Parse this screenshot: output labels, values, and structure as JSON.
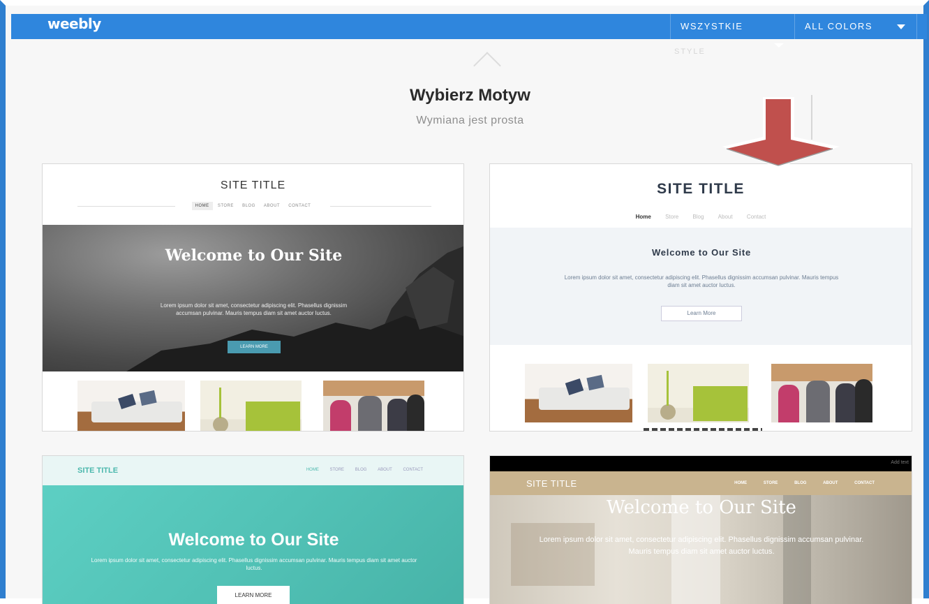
{
  "topbar": {
    "logo": "weebly",
    "style_filter": "WSZYSTKIE",
    "style_filter_wrap": "STYLE",
    "color_filter": "ALL COLORS"
  },
  "header": {
    "title": "Wybierz Motyw",
    "subtitle": "Wymiana jest prosta"
  },
  "colors": {
    "topbar": "#2f86dd",
    "annotation_arrow": "#c0504d"
  },
  "themes": [
    {
      "site_title": "SITE TITLE",
      "nav": [
        "HOME",
        "STORE",
        "BLOG",
        "ABOUT",
        "CONTACT"
      ],
      "active_nav": "HOME",
      "headline": "Welcome to Our Site",
      "body": "Lorem ipsum dolor sit amet, consectetur adipiscing elit. Phasellus dignissim accumsan pulvinar. Mauris tempus diam sit amet auctor luctus.",
      "button": "LEARN MORE"
    },
    {
      "site_title": "SITE TITLE",
      "nav": [
        "Home",
        "Store",
        "Blog",
        "About",
        "Contact"
      ],
      "active_nav": "Home",
      "headline": "Welcome to Our Site",
      "body": "Lorem ipsum dolor sit amet, consectetur adipiscing elit. Phasellus dignissim accumsan pulvinar. Mauris tempus diam sit amet auctor luctus.",
      "button": "Learn More"
    },
    {
      "site_title": "SITE TITLE",
      "nav": [
        "HOME",
        "STORE",
        "BLOG",
        "ABOUT",
        "CONTACT"
      ],
      "active_nav": "HOME",
      "headline": "Welcome to Our Site",
      "body": "Lorem ipsum dolor sit amet, consectetur adipiscing elit. Phasellus dignissim accumsan pulvinar. Mauris tempus diam sit amet auctor luctus.",
      "button": "LEARN MORE"
    },
    {
      "add_text": "Add text",
      "site_title": "SITE TITLE",
      "nav": [
        "HOME",
        "STORE",
        "BLOG",
        "ABOUT",
        "CONTACT"
      ],
      "headline": "Welcome to Our Site",
      "body": "Lorem ipsum dolor sit amet, consectetur adipiscing elit. Phasellus dignissim accumsan pulvinar. Mauris tempus diam sit amet auctor luctus."
    }
  ]
}
